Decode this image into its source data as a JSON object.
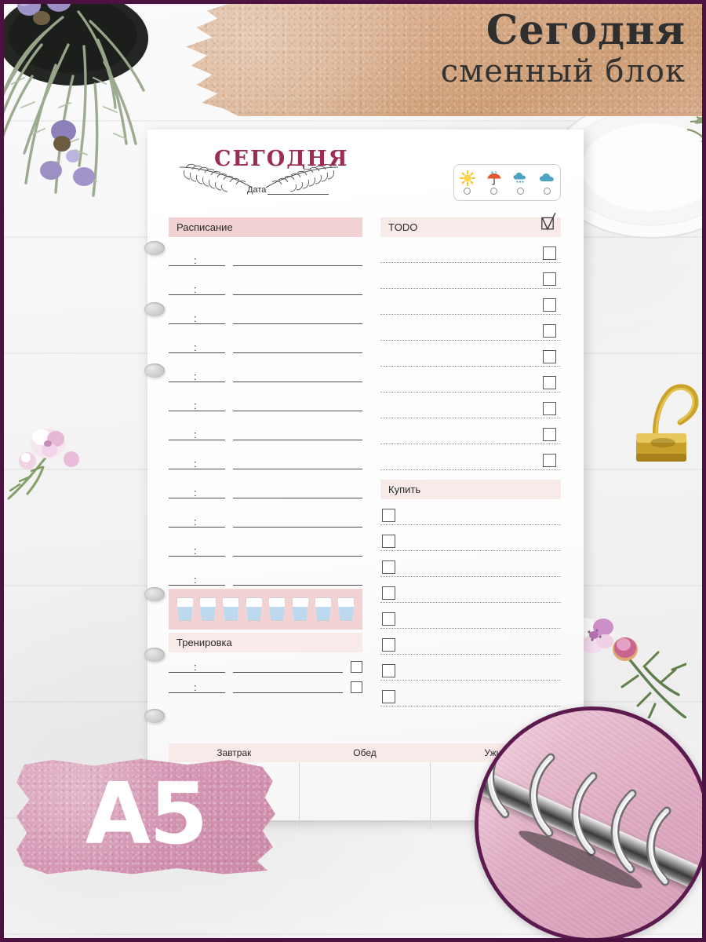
{
  "banner": {
    "title": "Сегодня",
    "subtitle": "сменный блок"
  },
  "badge": {
    "size_label": "A5"
  },
  "page": {
    "title": "СЕГОДНЯ",
    "date_label": "Дата",
    "weather": {
      "options": [
        {
          "name": "sunny",
          "icon": "sun-icon"
        },
        {
          "name": "rainy",
          "icon": "umbrella-icon"
        },
        {
          "name": "snowy",
          "icon": "snow-cloud-icon"
        },
        {
          "name": "cloudy",
          "icon": "cloud-icon"
        }
      ]
    },
    "schedule": {
      "heading": "Расписание",
      "rows": 12,
      "time_separator": ":"
    },
    "water": {
      "glasses": 8
    },
    "training": {
      "heading": "Тренировка",
      "rows": 2,
      "time_separator": ":"
    },
    "meals": {
      "columns": [
        "Завтрак",
        "Обед",
        "Ужин"
      ]
    },
    "todo": {
      "heading": "TODO",
      "rows": 9,
      "checkbox_side": "right"
    },
    "shopping": {
      "heading": "Купить",
      "rows": 8,
      "checkbox_side": "left"
    }
  },
  "colors": {
    "frame_purple": "#4b1242",
    "accent_pink_strong": "#f3d2d4",
    "accent_pink_soft": "#f8eae8",
    "title_maroon": "#9c2d4f",
    "water_blue": "#bcd9ef",
    "swatch_pink": "#d495b2",
    "kraft": "#d9ad8b"
  }
}
